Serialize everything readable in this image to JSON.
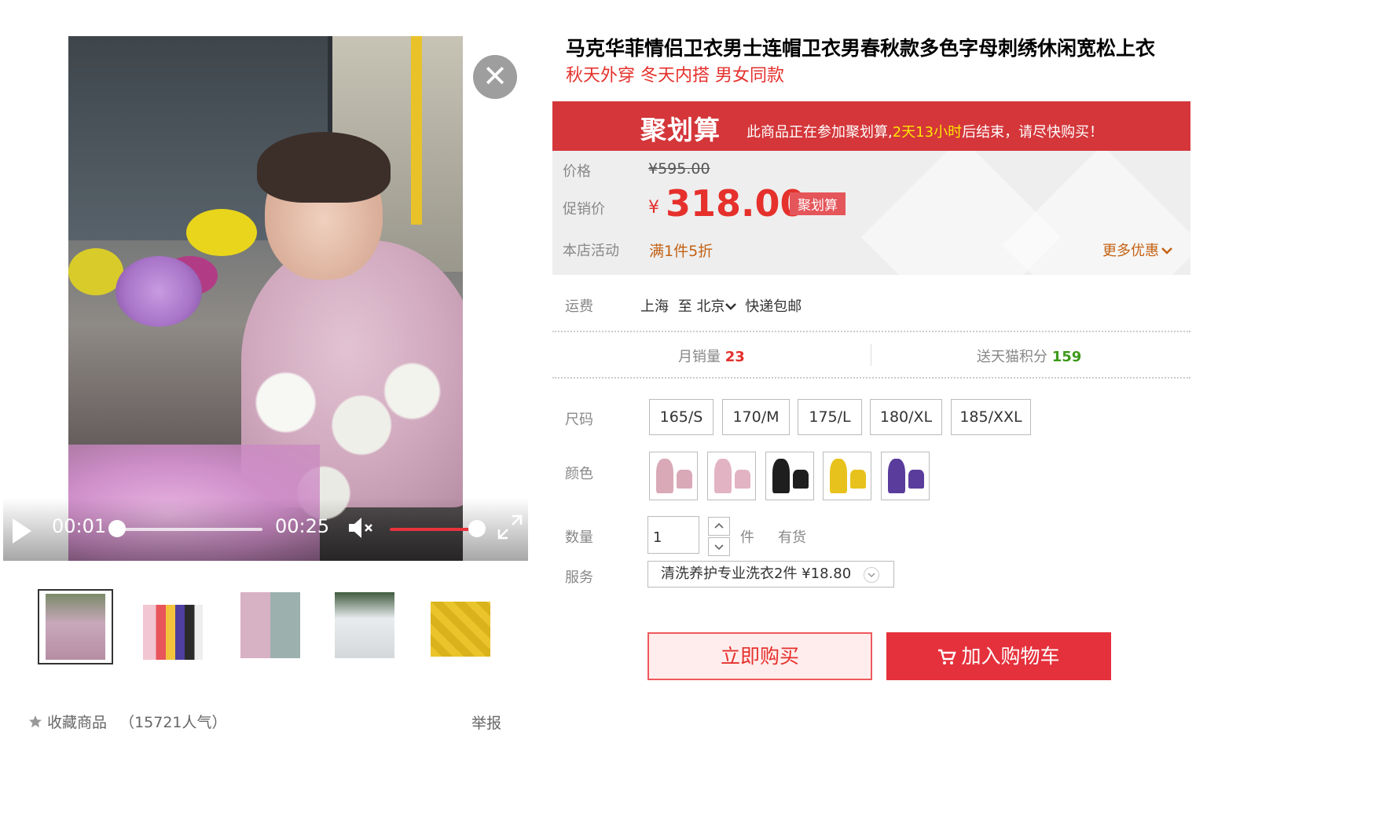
{
  "video": {
    "current_time": "00:01",
    "duration": "00:25",
    "progress": 0.04,
    "volume": 1.0
  },
  "thumbnails": [
    {
      "name": "thumb-pink-hoodie-model",
      "active": true
    },
    {
      "name": "thumb-color-rack",
      "active": false
    },
    {
      "name": "thumb-couple",
      "active": false
    },
    {
      "name": "thumb-white-hoodie",
      "active": false
    },
    {
      "name": "thumb-yellow-fabric",
      "active": false
    }
  ],
  "favorite": {
    "label": "收藏商品",
    "count_text": "（15721人气）"
  },
  "report_label": "举报",
  "product": {
    "title": "马克华菲情侣卫衣男士连帽卫衣男春秋款多色字母刺绣休闲宽松上衣",
    "subtitle": "秋天外穿  冬天内搭  男女同款"
  },
  "promo": {
    "brand": "聚划算",
    "text_before": "此商品正在参加聚划算,",
    "countdown": "2天13小时",
    "text_after": "后结束，请尽快购买！"
  },
  "price": {
    "orig_label": "价格",
    "orig_value": "¥595.00",
    "sale_label": "促销价",
    "sale_yen": "¥",
    "sale_value": "318.00",
    "sale_tag": "聚划算",
    "activity_label": "本店活动",
    "activity_value": "满1件5折",
    "more_deals": "更多优惠"
  },
  "shipping": {
    "label": "运费",
    "from": "上海",
    "to_word": "至",
    "to": "北京",
    "method": "快递包邮"
  },
  "stats": {
    "monthly_sales_label": "月销量",
    "monthly_sales_value": "23",
    "points_label": "送天猫积分",
    "points_value": "159"
  },
  "size": {
    "label": "尺码",
    "options": [
      "165/S",
      "170/M",
      "175/L",
      "180/XL",
      "185/XXL"
    ]
  },
  "color": {
    "label": "颜色",
    "options": [
      {
        "name": "pink-1",
        "hex": "#d9a9b8"
      },
      {
        "name": "pink-2",
        "hex": "#e2b3c3"
      },
      {
        "name": "black",
        "hex": "#1e1e1e"
      },
      {
        "name": "yellow",
        "hex": "#e8c21c"
      },
      {
        "name": "purple",
        "hex": "#5a3c9c"
      }
    ]
  },
  "quantity": {
    "label": "数量",
    "value": "1",
    "unit": "件",
    "stock": "有货"
  },
  "service": {
    "label": "服务",
    "selected": "清洗养护专业洗衣2件  ¥18.80"
  },
  "actions": {
    "buy_now": "立即购买",
    "add_cart": "加入购物车"
  },
  "colors": {
    "accent_red": "#e5302c",
    "promo_red": "#d4363a",
    "highlight_yellow": "#ffe600",
    "points_green": "#3e9a1a",
    "activity_orange": "#c46112"
  }
}
